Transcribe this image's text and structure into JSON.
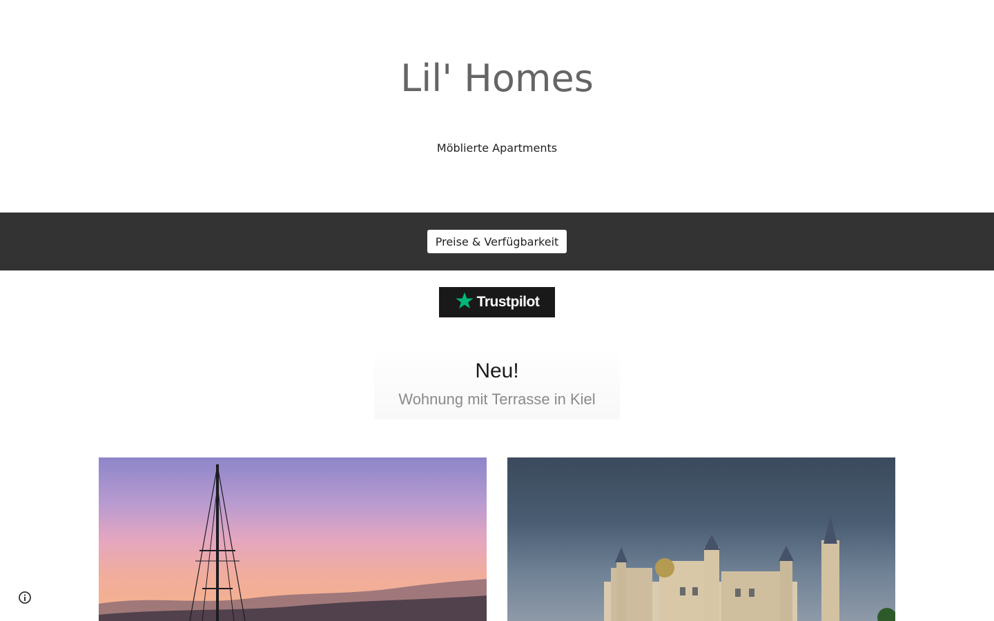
{
  "header": {
    "title": "Lil' Homes",
    "tagline": "Möblierte Apartments"
  },
  "nav": {
    "button_label": "Preise & Verfügbarkeit"
  },
  "trustpilot": {
    "label": "Trustpilot",
    "icon": "star-icon",
    "star_color": "#00b67a"
  },
  "banner": {
    "title": "Neu!",
    "subtitle": "Wohnung mit Terrasse in Kiel"
  },
  "footer": {
    "info_icon": "info-icon"
  },
  "colors": {
    "nav_background": "#333333",
    "title_color": "#656565"
  }
}
